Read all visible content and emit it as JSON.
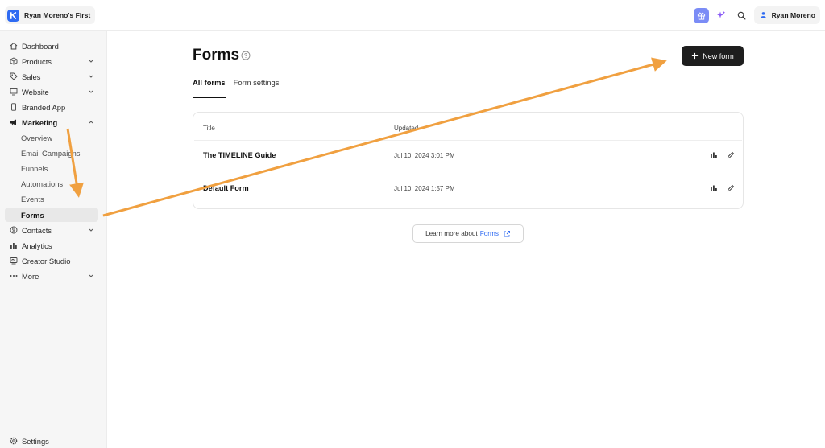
{
  "workspace": {
    "name": "Ryan Moreno's First"
  },
  "topbar": {
    "user_name": "Ryan Moreno",
    "gift_icon": "gift-icon",
    "sparkle_icon": "sparkle-icon",
    "search_icon": "search-icon",
    "user_icon": "user-icon"
  },
  "sidebar": {
    "items": [
      {
        "label": "Dashboard",
        "icon": "home-icon"
      },
      {
        "label": "Products",
        "icon": "box-icon"
      },
      {
        "label": "Sales",
        "icon": "tag-icon"
      },
      {
        "label": "Website",
        "icon": "monitor-icon"
      },
      {
        "label": "Branded App",
        "icon": "phone-icon"
      },
      {
        "label": "Marketing",
        "icon": "megaphone-icon"
      },
      {
        "label": "Contacts",
        "icon": "contact-icon"
      },
      {
        "label": "Analytics",
        "icon": "bar-chart-icon"
      },
      {
        "label": "Creator Studio",
        "icon": "studio-icon"
      },
      {
        "label": "More",
        "icon": "more-icon"
      }
    ],
    "marketing_sub": [
      "Overview",
      "Email Campaigns",
      "Funnels",
      "Automations",
      "Events",
      "Forms"
    ],
    "settings_label": "Settings"
  },
  "main": {
    "title": "Forms",
    "new_form_label": "New form",
    "tabs": [
      "All forms",
      "Form settings"
    ],
    "columns": [
      "Title",
      "Updated"
    ],
    "rows": [
      {
        "title": "The TIMELINE Guide",
        "updated": "Jul 10, 2024 3:01 PM"
      },
      {
        "title": "Default Form",
        "updated": "Jul 10, 2024 1:57 PM"
      }
    ],
    "learn_more_prefix": "Learn more about",
    "learn_more_link": "Forms"
  },
  "colors": {
    "accent": "#2f6bf2",
    "annotation": "#f0a040",
    "button_dark": "#1e1e1e"
  }
}
